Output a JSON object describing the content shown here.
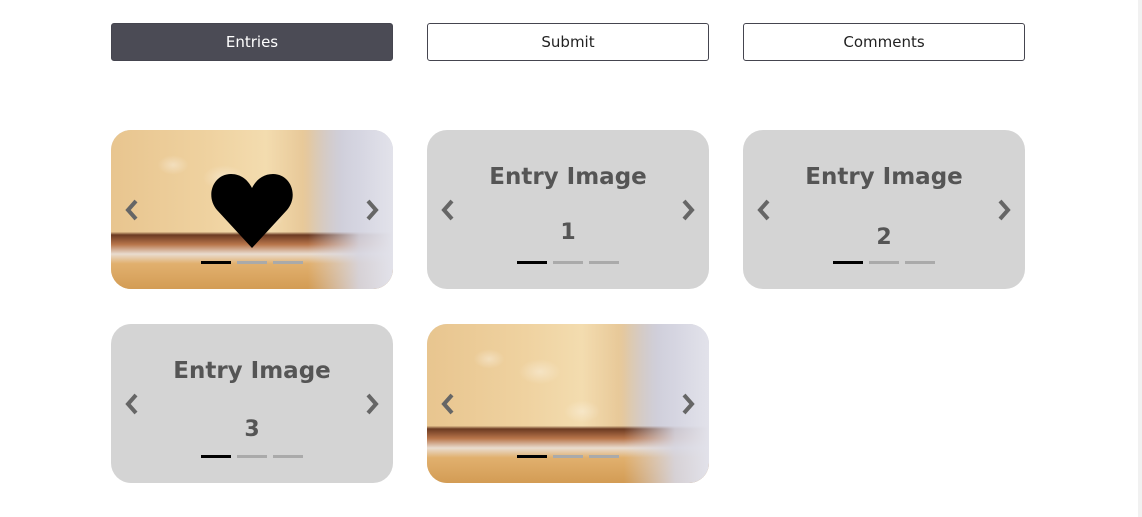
{
  "tabs": {
    "entries": "Entries",
    "submit": "Submit",
    "comments": "Comments"
  },
  "cards": [
    {
      "kind": "photo",
      "liked": true,
      "active_slide": 1,
      "slide_count": 3
    },
    {
      "kind": "placeholder",
      "title": "Entry Image",
      "number": "1",
      "active_slide": 1,
      "slide_count": 3
    },
    {
      "kind": "placeholder",
      "title": "Entry Image",
      "number": "2",
      "active_slide": 1,
      "slide_count": 3
    },
    {
      "kind": "placeholder",
      "title": "Entry Image",
      "number": "3",
      "active_slide": 1,
      "slide_count": 3
    },
    {
      "kind": "photo",
      "liked": false,
      "active_slide": 1,
      "slide_count": 3
    }
  ],
  "icons": {
    "prev": "chevron-left-icon",
    "next": "chevron-right-icon",
    "like": "heart-icon"
  },
  "colors": {
    "active_tab_bg": "#4b4b55",
    "card_bg": "#d4d4d4",
    "arrow": "#666666",
    "indicator_active": "#000000",
    "indicator_inactive": "#aaaaaa"
  }
}
